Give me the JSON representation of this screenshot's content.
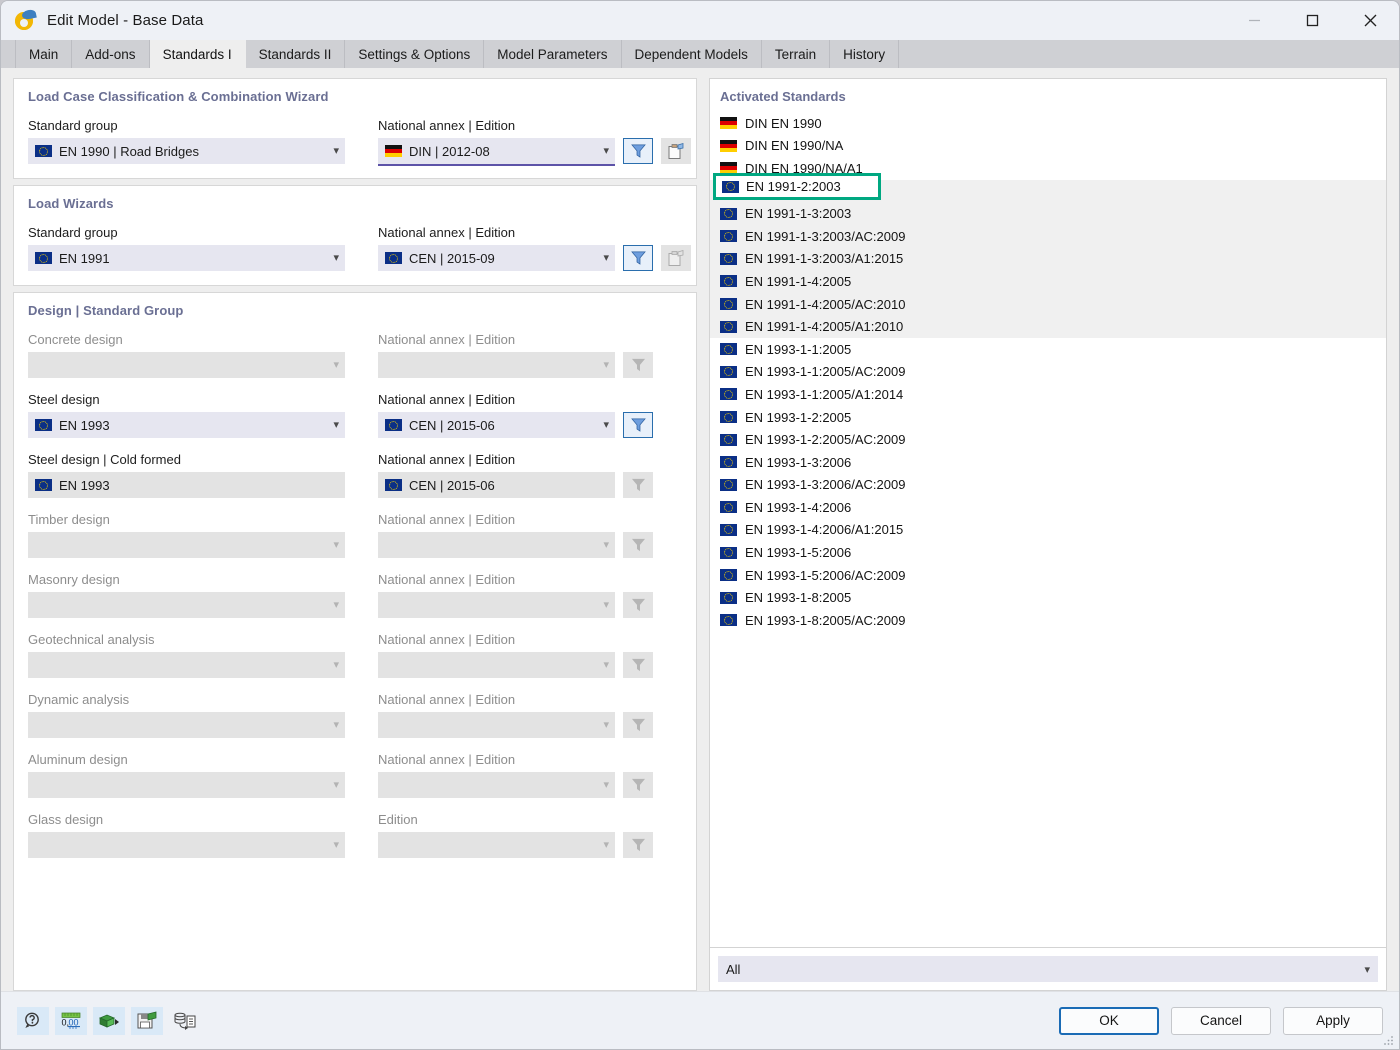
{
  "window": {
    "title": "Edit Model - Base Data",
    "app_icon": "rfem-icon",
    "controls": {
      "minimize": "–",
      "maximize": "□",
      "close": "✕"
    }
  },
  "tabs": [
    {
      "label": "Main",
      "active": false
    },
    {
      "label": "Add-ons",
      "active": false
    },
    {
      "label": "Standards I",
      "active": true
    },
    {
      "label": "Standards II",
      "active": false
    },
    {
      "label": "Settings & Options",
      "active": false
    },
    {
      "label": "Model Parameters",
      "active": false
    },
    {
      "label": "Dependent Models",
      "active": false
    },
    {
      "label": "Terrain",
      "active": false
    },
    {
      "label": "History",
      "active": false
    }
  ],
  "sections": {
    "load_case": {
      "title": "Load Case Classification & Combination Wizard",
      "left_label": "Standard group",
      "right_label": "National annex | Edition",
      "left_value": "EN 1990 | Road Bridges",
      "left_flag": "eu",
      "right_value": "DIN | 2012-08",
      "right_flag": "de",
      "filter_button": "filter-icon",
      "copy_button": "clipboard-icon"
    },
    "load_wizards": {
      "title": "Load Wizards",
      "left_label": "Standard group",
      "right_label": "National annex | Edition",
      "left_value": "EN 1991",
      "left_flag": "eu",
      "right_value": "CEN | 2015-09",
      "right_flag": "de_no",
      "filter_button": "filter-icon",
      "copy_button": "clipboard-icon"
    },
    "design": {
      "title": "Design | Standard Group",
      "annex_label": "National annex | Edition",
      "edition_label": "Edition",
      "rows": [
        {
          "label": "Concrete design",
          "value": "",
          "flag": "",
          "annex_label": "National annex | Edition",
          "annex_value": "",
          "annex_flag": "",
          "enabled": false
        },
        {
          "label": "Steel design",
          "value": "EN 1993",
          "flag": "eu",
          "annex_label": "National annex | Edition",
          "annex_value": "CEN | 2015-06",
          "annex_flag": "eu",
          "enabled": true
        },
        {
          "label": "Steel design | Cold formed",
          "value": "EN 1993",
          "flag": "eu",
          "annex_label": "National annex | Edition",
          "annex_value": "CEN | 2015-06",
          "annex_flag": "eu",
          "enabled": "partial"
        },
        {
          "label": "Timber design",
          "value": "",
          "flag": "",
          "annex_label": "National annex | Edition",
          "annex_value": "",
          "annex_flag": "",
          "enabled": false
        },
        {
          "label": "Masonry design",
          "value": "",
          "flag": "",
          "annex_label": "National annex | Edition",
          "annex_value": "",
          "annex_flag": "",
          "enabled": false
        },
        {
          "label": "Geotechnical analysis",
          "value": "",
          "flag": "",
          "annex_label": "National annex | Edition",
          "annex_value": "",
          "annex_flag": "",
          "enabled": false
        },
        {
          "label": "Dynamic analysis",
          "value": "",
          "flag": "",
          "annex_label": "National annex | Edition",
          "annex_value": "",
          "annex_flag": "",
          "enabled": false
        },
        {
          "label": "Aluminum design",
          "value": "",
          "flag": "",
          "annex_label": "National annex | Edition",
          "annex_value": "",
          "annex_flag": "",
          "enabled": false
        },
        {
          "label": "Glass design",
          "value": "",
          "flag": "",
          "annex_label": "Edition",
          "annex_value": "",
          "annex_flag": "",
          "enabled": false
        }
      ]
    }
  },
  "activated_standards": {
    "title": "Activated Standards",
    "highlighted": "EN 1991-2:2003",
    "highlight_color": "#00a881",
    "filter_value": "All",
    "items": [
      {
        "label": "DIN EN 1990",
        "flag": "de",
        "selected": false
      },
      {
        "label": "DIN EN 1990/NA",
        "flag": "de",
        "selected": false
      },
      {
        "label": "DIN EN 1990/NA/A1",
        "flag": "de",
        "selected": false
      },
      {
        "label": "EN 1991-2:2003",
        "flag": "eu",
        "selected": true
      },
      {
        "label": "EN 1991-1-3:2003",
        "flag": "eu",
        "selected": true
      },
      {
        "label": "EN 1991-1-3:2003/AC:2009",
        "flag": "eu",
        "selected": true
      },
      {
        "label": "EN 1991-1-3:2003/A1:2015",
        "flag": "eu",
        "selected": true
      },
      {
        "label": "EN 1991-1-4:2005",
        "flag": "eu",
        "selected": true
      },
      {
        "label": "EN 1991-1-4:2005/AC:2010",
        "flag": "eu",
        "selected": true
      },
      {
        "label": "EN 1991-1-4:2005/A1:2010",
        "flag": "eu",
        "selected": true
      },
      {
        "label": "EN 1993-1-1:2005",
        "flag": "eu",
        "selected": false
      },
      {
        "label": "EN 1993-1-1:2005/AC:2009",
        "flag": "eu",
        "selected": false
      },
      {
        "label": "EN 1993-1-1:2005/A1:2014",
        "flag": "eu",
        "selected": false
      },
      {
        "label": "EN 1993-1-2:2005",
        "flag": "eu",
        "selected": false
      },
      {
        "label": "EN 1993-1-2:2005/AC:2009",
        "flag": "eu",
        "selected": false
      },
      {
        "label": "EN 1993-1-3:2006",
        "flag": "eu",
        "selected": false
      },
      {
        "label": "EN 1993-1-3:2006/AC:2009",
        "flag": "eu",
        "selected": false
      },
      {
        "label": "EN 1993-1-4:2006",
        "flag": "eu",
        "selected": false
      },
      {
        "label": "EN 1993-1-4:2006/A1:2015",
        "flag": "eu",
        "selected": false
      },
      {
        "label": "EN 1993-1-5:2006",
        "flag": "eu",
        "selected": false
      },
      {
        "label": "EN 1993-1-5:2006/AC:2009",
        "flag": "eu",
        "selected": false
      },
      {
        "label": "EN 1993-1-8:2005",
        "flag": "eu",
        "selected": false
      },
      {
        "label": "EN 1993-1-8:2005/AC:2009",
        "flag": "eu",
        "selected": false
      }
    ]
  },
  "footer": {
    "tools": [
      {
        "name": "help-icon"
      },
      {
        "name": "units-icon",
        "label": "0,00"
      },
      {
        "name": "export-icon"
      },
      {
        "name": "save-icon"
      },
      {
        "name": "database-icon"
      }
    ],
    "ok_label": "OK",
    "cancel_label": "Cancel",
    "apply_label": "Apply"
  },
  "colors": {
    "accent_blue": "#2a6ead",
    "highlight_teal": "#00a881",
    "field_bg": "#e6e6f0",
    "header_text": "#6a6f93",
    "focus_underline": "#5d53a8"
  }
}
